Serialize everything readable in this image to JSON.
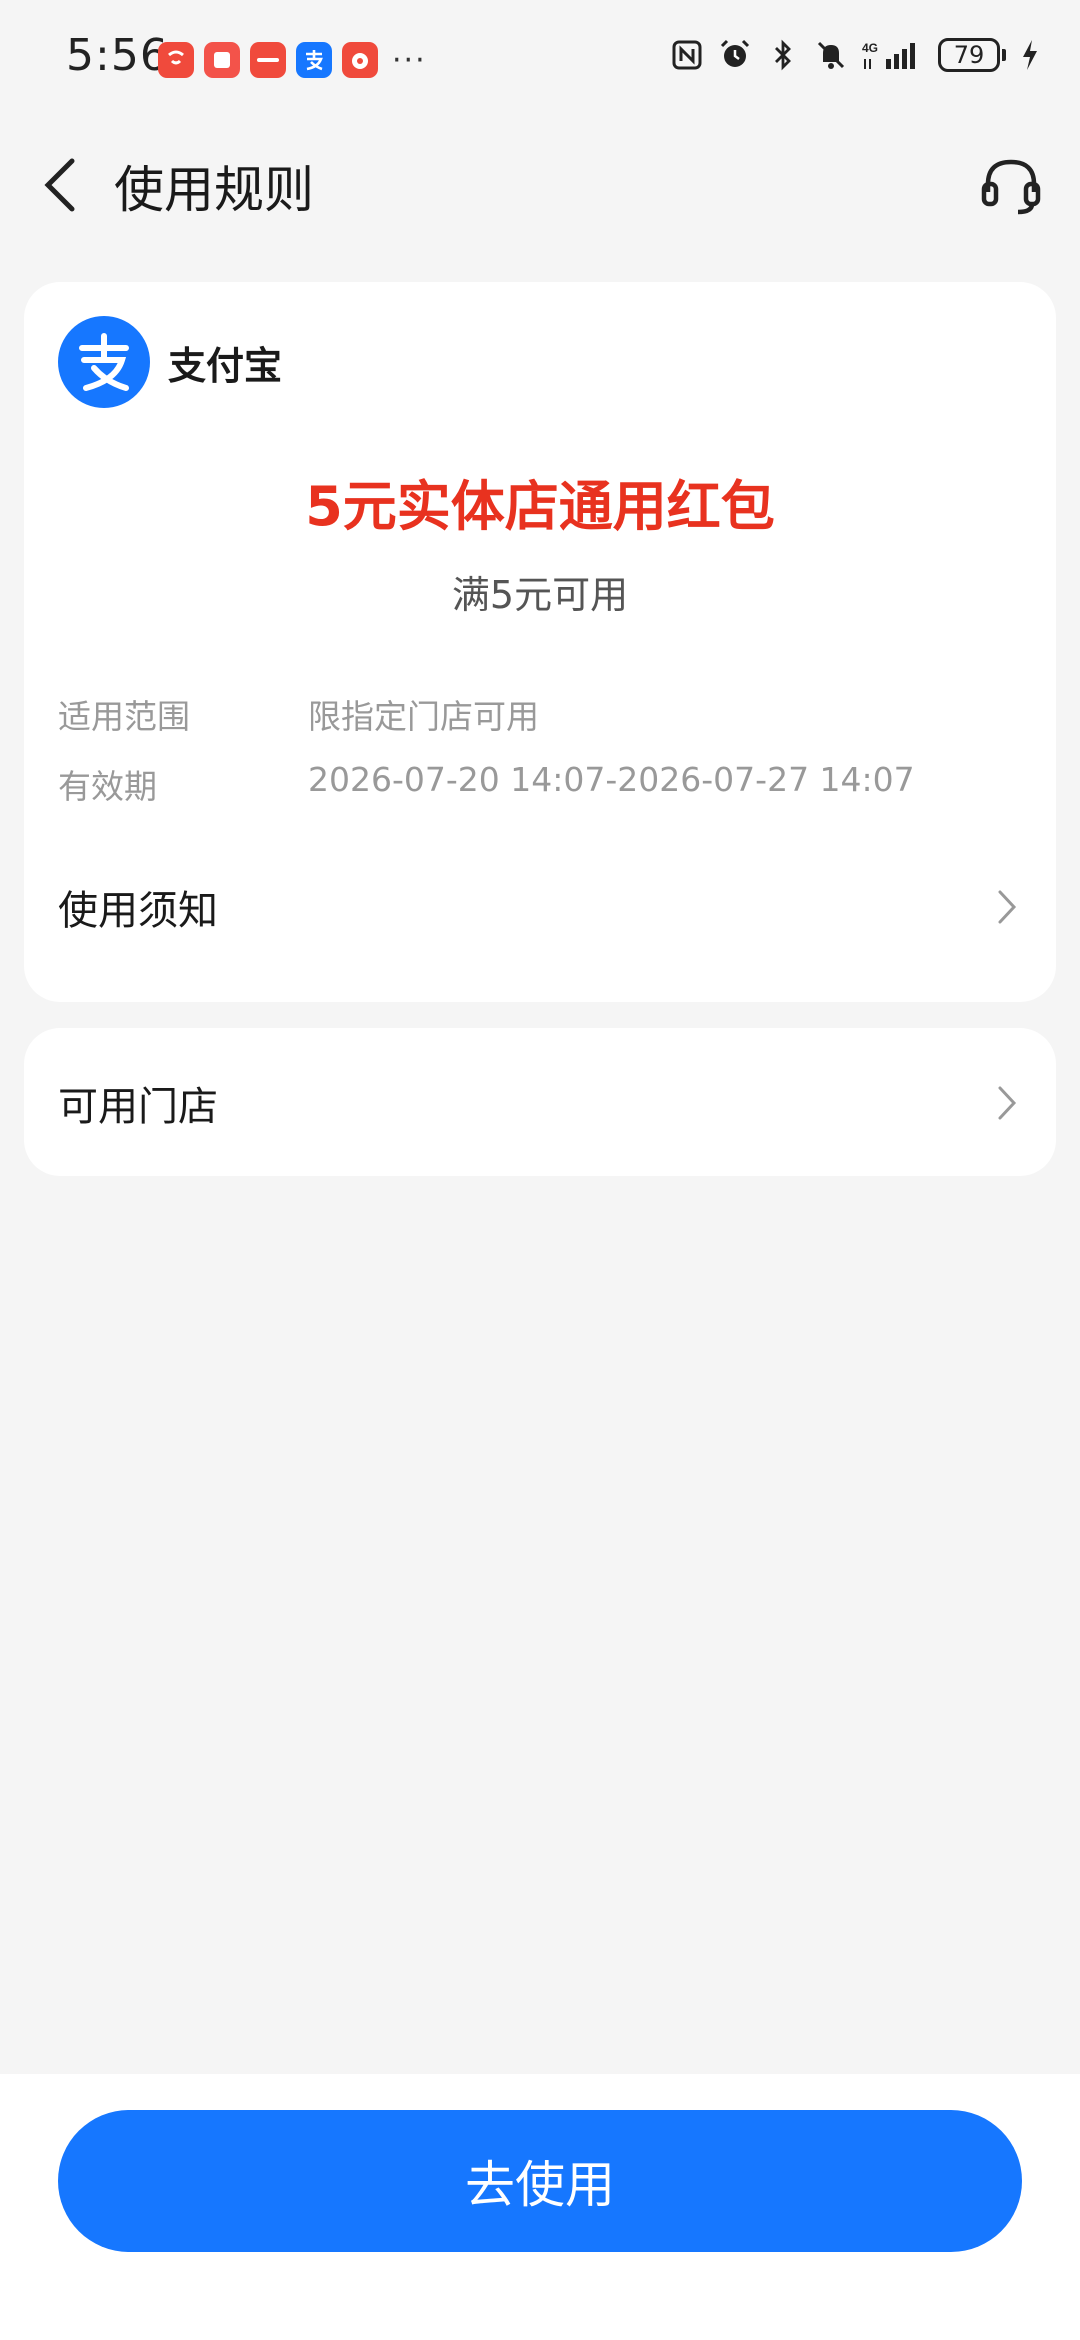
{
  "status_bar": {
    "time": "5:56",
    "more": "···",
    "battery": "79"
  },
  "header": {
    "title": "使用规则"
  },
  "coupon": {
    "brand_name": "支付宝",
    "title": "5元实体店通用红包",
    "condition": "满5元可用",
    "scope_label": "适用范围",
    "scope_value": "限指定门店可用",
    "validity_label": "有效期",
    "validity_value": "2026-07-20 14:07-2026-07-27 14:07",
    "notice_label": "使用须知"
  },
  "stores": {
    "label": "可用门店"
  },
  "actions": {
    "use_button": "去使用"
  },
  "colors": {
    "accent": "#1677ff",
    "coupon_red": "#e8321f",
    "background": "#f5f5f5"
  }
}
